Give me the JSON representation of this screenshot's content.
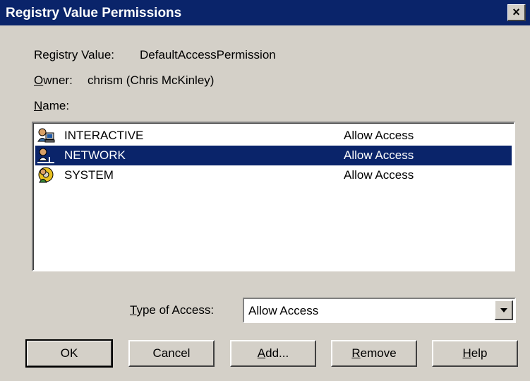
{
  "window": {
    "title": "Registry Value Permissions",
    "close_glyph": "×"
  },
  "info": {
    "registry_value_label": "Registry Value:",
    "registry_value": "DefaultAccessPermission",
    "owner_label_mnemonic": "O",
    "owner_label_rest": "wner:",
    "owner_value": "chrism (Chris McKinley)",
    "name_label_mnemonic": "N",
    "name_label_rest": "ame:"
  },
  "permissions": [
    {
      "name": "INTERACTIVE",
      "access": "Allow Access",
      "icon": "interactive-users-icon",
      "selected": false
    },
    {
      "name": "NETWORK",
      "access": "Allow Access",
      "icon": "network-users-icon",
      "selected": true
    },
    {
      "name": "SYSTEM",
      "access": "Allow Access",
      "icon": "system-users-icon",
      "selected": false
    }
  ],
  "access_type": {
    "label_mnemonic": "T",
    "label_rest": "ype of Access:",
    "value": "Allow Access"
  },
  "buttons": {
    "ok": "OK",
    "cancel": "Cancel",
    "add_mnemonic": "A",
    "add_rest": "dd...",
    "remove_mnemonic": "R",
    "remove_rest": "emove",
    "help_mnemonic": "H",
    "help_rest": "elp"
  },
  "colors": {
    "titlebar": "#0a246a",
    "dialog_face": "#d4d0c8",
    "selection": "#0a246a"
  }
}
